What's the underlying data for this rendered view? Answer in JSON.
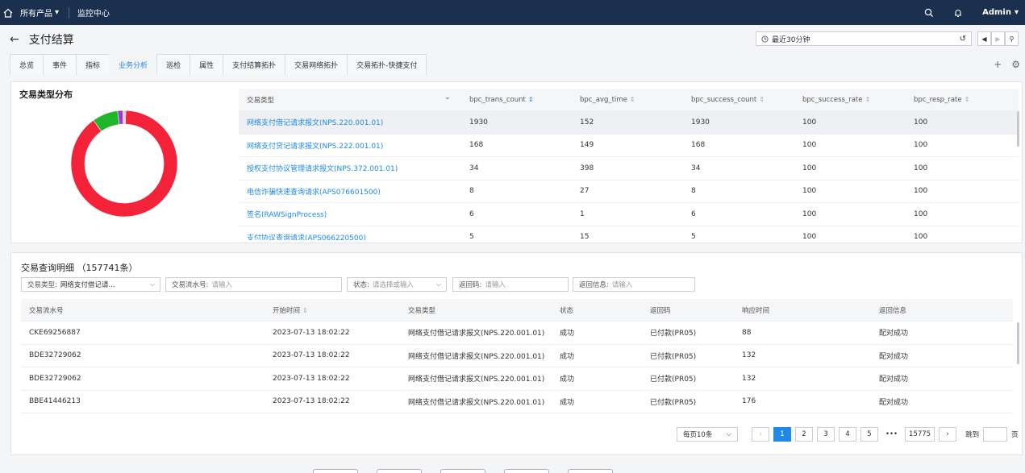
{
  "topbar": {
    "products": "所有产品",
    "monitor": "监控中心",
    "user": "Admin"
  },
  "title": "支付结算",
  "time_range": "最近30分钟",
  "tabs": [
    "总览",
    "事件",
    "指标",
    "业务分析",
    "巡检",
    "属性",
    "支付结算拓扑",
    "交易网络拓扑",
    "交易拓扑-快捷支付"
  ],
  "active_tab": "业务分析",
  "dist": {
    "title": "交易类型分布",
    "columns": [
      "交易类型",
      "bpc_trans_count",
      "bpc_avg_time",
      "bpc_success_count",
      "bpc_success_rate",
      "bpc_resp_rate"
    ],
    "rows": [
      [
        "网络支付借记请求报文(NPS.220.001.01)",
        "1930",
        "152",
        "1930",
        "100",
        "100"
      ],
      [
        "网络支付贷记请求报文(NPS.222.001.01)",
        "168",
        "149",
        "168",
        "100",
        "100"
      ],
      [
        "授权支付协议管理请求报文(NPS.372.001.01)",
        "34",
        "398",
        "34",
        "100",
        "100"
      ],
      [
        "电信诈骗快速查询请求(APS076601500)",
        "8",
        "27",
        "8",
        "100",
        "100"
      ],
      [
        "签名(RAWSignProcess)",
        "6",
        "1",
        "6",
        "100",
        "100"
      ],
      [
        "支付协议查询请求(APS066220500)",
        "5",
        "15",
        "5",
        "100",
        "100"
      ]
    ]
  },
  "chart_data": {
    "type": "pie",
    "labels": [
      "网络支付借记请求报文(NPS.220.001.01)",
      "网络支付贷记请求报文(NPS.222.001.01)",
      "授权支付协议管理请求报文(NPS.372.001.01)",
      "电信诈骗快速查询请求(APS076601500)",
      "签名(RAWSignProcess)",
      "支付协议查询请求(APS066220500)"
    ],
    "values": [
      1930,
      168,
      34,
      8,
      6,
      5
    ],
    "colors": [
      "#f5233a",
      "#21b52a",
      "#9c39d6",
      "#f7a11a",
      "#e63bd3",
      "#2f80e0"
    ],
    "donut": true
  },
  "detail": {
    "title": "交易查询明细",
    "count": "（157741条）",
    "filters": {
      "type_label": "交易类型:",
      "type_value": "网络支付借记请...",
      "serial_label": "交易流水号:",
      "serial_ph": "请输入",
      "status_label": "状态:",
      "status_ph": "请选择或输入",
      "code_label": "返回码:",
      "code_ph": "请输入",
      "msg_label": "返回信息:",
      "msg_ph": "请输入"
    },
    "columns": [
      "交易流水号",
      "开始时间",
      "交易类型",
      "状态",
      "返回码",
      "响应时间",
      "返回信息"
    ],
    "rows": [
      [
        "CKE69256887",
        "2023-07-13 18:02:22",
        "网络支付借记请求报文(NPS.220.001.01)",
        "成功",
        "已付款(PR05)",
        "88",
        "配对成功"
      ],
      [
        "BDE32729062",
        "2023-07-13 18:02:22",
        "网络支付借记请求报文(NPS.220.001.01)",
        "成功",
        "已付款(PR05)",
        "132",
        "配对成功"
      ],
      [
        "BDE32729062",
        "2023-07-13 18:02:22",
        "网络支付借记请求报文(NPS.220.001.01)",
        "成功",
        "已付款(PR05)",
        "132",
        "配对成功"
      ],
      [
        "BBE41446213",
        "2023-07-13 18:02:22",
        "网络支付借记请求报文(NPS.220.001.01)",
        "成功",
        "已付款(PR05)",
        "176",
        "配对成功"
      ]
    ]
  },
  "pager": {
    "size": "每页10条",
    "pages": [
      "1",
      "2",
      "3",
      "4",
      "5"
    ],
    "more": "•••",
    "last": "15775",
    "goto": "跳到",
    "unit": "页"
  }
}
